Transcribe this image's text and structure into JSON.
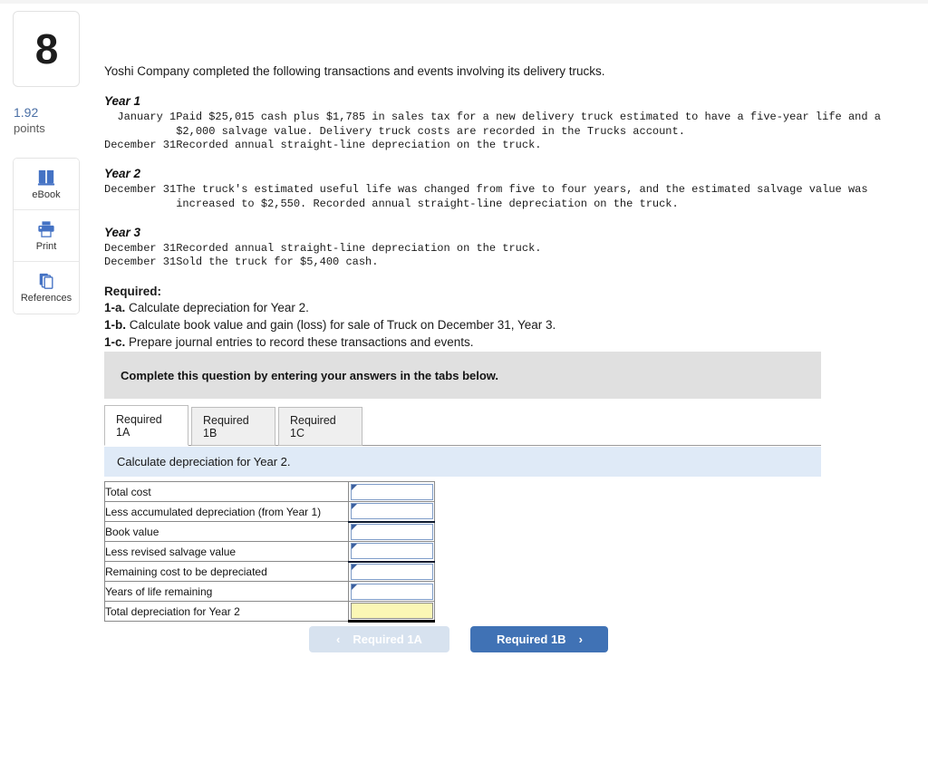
{
  "sidebar": {
    "question_number": "8",
    "points_value": "1.92",
    "points_label": "points",
    "tools": [
      {
        "id": "ebook",
        "label": "eBook",
        "icon": "book-icon"
      },
      {
        "id": "print",
        "label": "Print",
        "icon": "printer-icon"
      },
      {
        "id": "references",
        "label": "References",
        "icon": "copy-pages-icon"
      }
    ]
  },
  "problem": {
    "intro": "Yoshi Company completed the following transactions and events involving its delivery trucks.",
    "years": [
      {
        "heading": "Year 1",
        "events": [
          {
            "date": "January 1",
            "text": "Paid $25,015 cash plus $1,785 in sales tax for a new delivery truck estimated to have a five-year life and a\n$2,000 salvage value. Delivery truck costs are recorded in the Trucks account."
          },
          {
            "date": "December 31",
            "text": "Recorded annual straight-line depreciation on the truck."
          }
        ]
      },
      {
        "heading": "Year 2",
        "events": [
          {
            "date": "December 31",
            "text": "The truck's estimated useful life was changed from five to four years, and the estimated salvage value was\nincreased to $2,550. Recorded annual straight-line depreciation on the truck."
          }
        ]
      },
      {
        "heading": "Year 3",
        "events": [
          {
            "date": "December 31",
            "text": "Recorded annual straight-line depreciation on the truck."
          },
          {
            "date": "December 31",
            "text": "Sold the truck for $5,400 cash."
          }
        ]
      }
    ],
    "required_heading": "Required:",
    "required_items": [
      {
        "marker": "1-a.",
        "text": " Calculate depreciation for Year 2."
      },
      {
        "marker": "1-b.",
        "text": " Calculate book value and gain (loss) for sale of Truck on December 31, Year 3."
      },
      {
        "marker": "1-c.",
        "text": " Prepare journal entries to record these transactions and events."
      }
    ]
  },
  "banner": {
    "text": "Complete this question by entering your answers in the tabs below."
  },
  "tabs": [
    {
      "id": "required-1a",
      "label": "Required 1A",
      "active": true
    },
    {
      "id": "required-1b",
      "label": "Required 1B",
      "active": false
    },
    {
      "id": "required-1c",
      "label": "Required 1C",
      "active": false
    }
  ],
  "prompt": {
    "text": "Calculate depreciation for Year 2."
  },
  "answer_table": {
    "rows": [
      {
        "label": "Total cost",
        "value": "",
        "style": "normal"
      },
      {
        "label": "Less accumulated depreciation (from Year 1)",
        "value": "",
        "style": "subtotal"
      },
      {
        "label": "Book value",
        "value": "",
        "style": "normal"
      },
      {
        "label": "Less revised salvage value",
        "value": "",
        "style": "subtotal"
      },
      {
        "label": "Remaining cost to be depreciated",
        "value": "",
        "style": "normal"
      },
      {
        "label": "Years of life remaining",
        "value": "",
        "style": "normal"
      },
      {
        "label": "Total depreciation for Year 2",
        "value": "",
        "style": "grandtotal"
      }
    ]
  },
  "nav": {
    "prev_label": "Required 1A",
    "prev_chevron": "‹",
    "next_label": "Required 1B",
    "next_chevron": "›"
  },
  "colors": {
    "accent_blue": "#4072b5",
    "icon_blue": "#4472c4",
    "banner_gray": "#e0e0e0",
    "prompt_blue": "#dfeaf7",
    "input_border_blue": "#7e9cc8",
    "answer_yellow": "#fbf7b5",
    "points_blue": "#4a6fa5"
  }
}
